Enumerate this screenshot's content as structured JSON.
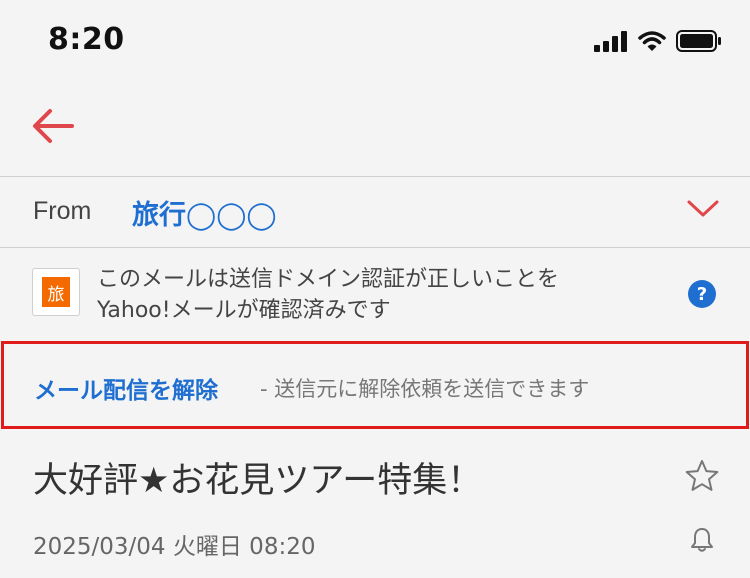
{
  "status_bar": {
    "time": "8:20",
    "icons": [
      "signal-icon",
      "wifi-icon",
      "battery-icon"
    ]
  },
  "nav": {
    "back_icon": "back-arrow-icon"
  },
  "header": {
    "from_label": "From",
    "sender": "旅行◯◯◯",
    "expand_icon": "chevron-down-icon"
  },
  "auth_notice": {
    "logo_text": "旅",
    "line1": "このメールは送信ドメイン認証が正しいことを",
    "line2": "Yahoo!メールが確認済みです",
    "help_icon": "help-icon",
    "help_glyph": "?"
  },
  "unsubscribe": {
    "link_label": "メール配信を解除",
    "description": "- 送信元に解除依頼を送信できます"
  },
  "message": {
    "subject": "大好評★お花見ツアー特集！",
    "date": "2025/03/04 火曜日 08:20",
    "star_icon": "star-icon",
    "bell_icon": "bell-icon"
  },
  "colors": {
    "accent_red": "#e0474c",
    "link_blue": "#1f6fd1",
    "highlight_border": "#e11a1a",
    "logo_orange": "#f56a00"
  }
}
